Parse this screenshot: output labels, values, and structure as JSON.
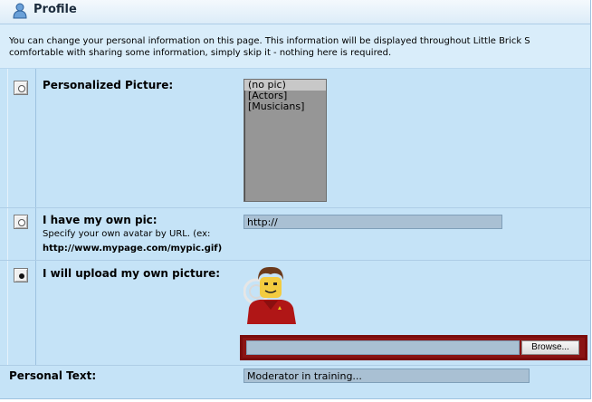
{
  "header": {
    "title": "Profile",
    "icon": "user-profile-icon"
  },
  "intro": {
    "line1": "You can change your personal information on this page. This information will be displayed throughout Little Brick S",
    "line2": "comfortable with sharing some information, simply skip it - nothing here is required."
  },
  "picture": {
    "personalized_label": "Personalized Picture:",
    "options": [
      "(no pic)",
      "[Actors]",
      "[Musicians]"
    ],
    "selected_option": "(no pic)",
    "own_pic_label": "I have my own pic:",
    "own_pic_hint": "Specify your own avatar by URL. (ex:",
    "own_pic_example": "http://www.mypage.com/mypic.gif)",
    "url_value": "http://",
    "upload_label": "I will upload my own picture:",
    "avatar_alt": "lego-minifig-avatar",
    "selected_radio": "upload",
    "browse_label": "Browse..."
  },
  "personal_text": {
    "label": "Personal Text:",
    "value": "Moderator in training..."
  },
  "colors": {
    "panel": "#c5e3f7",
    "highlight_border": "#7a0c0c",
    "field": "#a9c0d3",
    "listbox": "#969696"
  }
}
